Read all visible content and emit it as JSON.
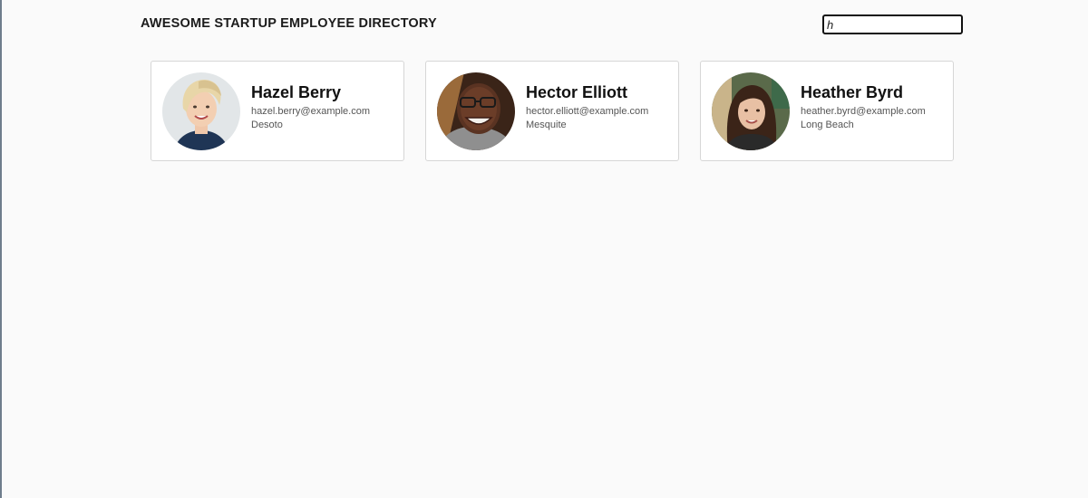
{
  "header": {
    "title": "AWESOME STARTUP EMPLOYEE DIRECTORY"
  },
  "search": {
    "value": "h",
    "placeholder": ""
  },
  "employees": [
    {
      "name": "Hazel Berry",
      "email": "hazel.berry@example.com",
      "city": "Desoto"
    },
    {
      "name": "Hector Elliott",
      "email": "hector.elliott@example.com",
      "city": "Mesquite"
    },
    {
      "name": "Heather Byrd",
      "email": "heather.byrd@example.com",
      "city": "Long Beach"
    }
  ]
}
